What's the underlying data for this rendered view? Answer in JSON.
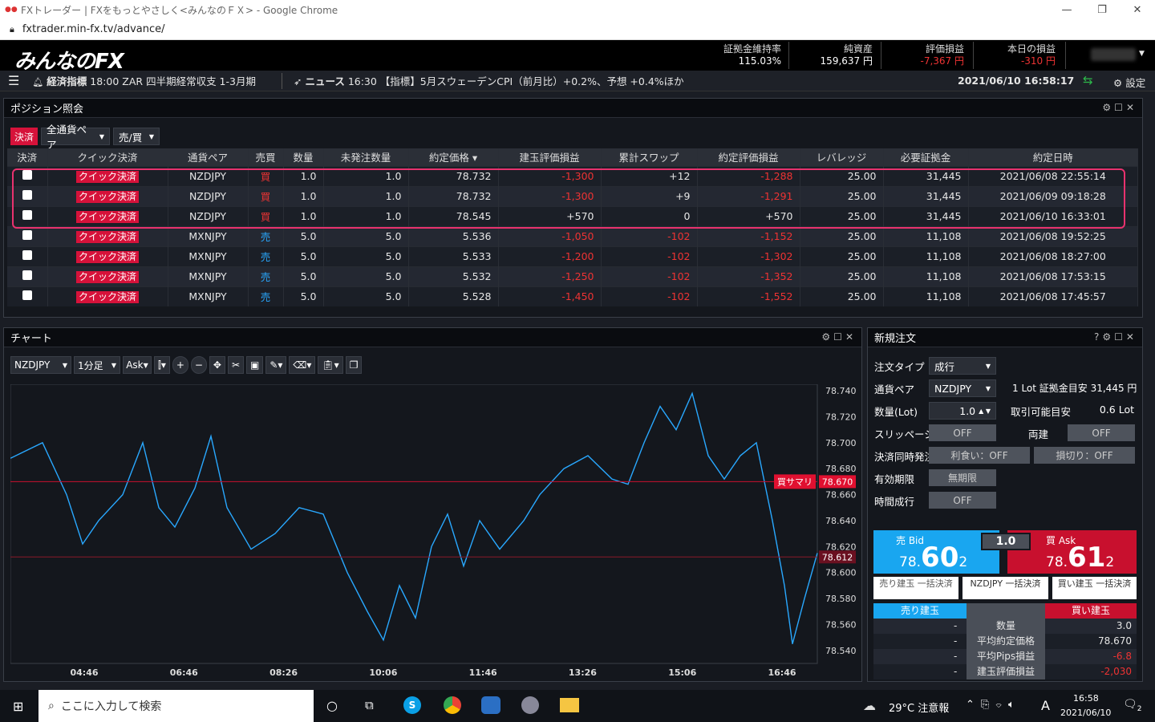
{
  "browser": {
    "title": "FXトレーダー | FXをもっとやさしく<みんなのＦＸ> - Google Chrome",
    "url": "fxtrader.min-fx.tv/advance/"
  },
  "header": {
    "logo": "みんなのFX",
    "stats": [
      {
        "label": "証拠金維持率",
        "value": "115.03%",
        "neg": false
      },
      {
        "label": "純資産",
        "value": "159,637 円",
        "neg": false
      },
      {
        "label": "評価損益",
        "value": "-7,367 円",
        "neg": true
      },
      {
        "label": "本日の損益",
        "value": "-310 円",
        "neg": true
      }
    ]
  },
  "news": {
    "econ_label": "経済指標",
    "econ_text": "18:00 ZAR 四半期経常収支 1-3月期",
    "news_label": "ニュース",
    "news_text": "16:30 【指標】5月スウェーデンCPI（前月比）+0.2%、予想 +0.4%ほか",
    "datetime": "2021/06/10 16:58:17",
    "settings": "設定"
  },
  "positions": {
    "title": "ポジション照会",
    "filters": {
      "settle": "決済",
      "pair": "全通貨ペア",
      "side": "売/買"
    },
    "columns": [
      "決済",
      "クイック決済",
      "通貨ペア",
      "売買",
      "数量",
      "未発注数量",
      "約定価格 ▾",
      "建玉評価損益",
      "累計スワップ",
      "約定評価損益",
      "レバレッジ",
      "必要証拠金",
      "約定日時"
    ],
    "quick_label": "クイック決済",
    "rows": [
      {
        "pair": "NZDJPY",
        "side": "買",
        "qty": "1.0",
        "unfilled": "1.0",
        "price": "78.732",
        "pl": "-1,300",
        "swap": "+12",
        "total": "-1,288",
        "lev": "25.00",
        "margin": "31,445",
        "dt": "2021/06/08 22:55:14"
      },
      {
        "pair": "NZDJPY",
        "side": "買",
        "qty": "1.0",
        "unfilled": "1.0",
        "price": "78.732",
        "pl": "-1,300",
        "swap": "+9",
        "total": "-1,291",
        "lev": "25.00",
        "margin": "31,445",
        "dt": "2021/06/09 09:18:28"
      },
      {
        "pair": "NZDJPY",
        "side": "買",
        "qty": "1.0",
        "unfilled": "1.0",
        "price": "78.545",
        "pl": "+570",
        "swap": "0",
        "total": "+570",
        "lev": "25.00",
        "margin": "31,445",
        "dt": "2021/06/10 16:33:01"
      },
      {
        "pair": "MXNJPY",
        "side": "売",
        "qty": "5.0",
        "unfilled": "5.0",
        "price": "5.536",
        "pl": "-1,050",
        "swap": "-102",
        "total": "-1,152",
        "lev": "25.00",
        "margin": "11,108",
        "dt": "2021/06/08 19:52:25"
      },
      {
        "pair": "MXNJPY",
        "side": "売",
        "qty": "5.0",
        "unfilled": "5.0",
        "price": "5.533",
        "pl": "-1,200",
        "swap": "-102",
        "total": "-1,302",
        "lev": "25.00",
        "margin": "11,108",
        "dt": "2021/06/08 18:27:00"
      },
      {
        "pair": "MXNJPY",
        "side": "売",
        "qty": "5.0",
        "unfilled": "5.0",
        "price": "5.532",
        "pl": "-1,250",
        "swap": "-102",
        "total": "-1,352",
        "lev": "25.00",
        "margin": "11,108",
        "dt": "2021/06/08 17:53:15"
      },
      {
        "pair": "MXNJPY",
        "side": "売",
        "qty": "5.0",
        "unfilled": "5.0",
        "price": "5.528",
        "pl": "-1,450",
        "swap": "-102",
        "total": "-1,552",
        "lev": "25.00",
        "margin": "11,108",
        "dt": "2021/06/08 17:45:57"
      }
    ]
  },
  "chart": {
    "title": "チャート",
    "toolbar": {
      "pair": "NZDJPY",
      "interval": "1分足",
      "side": "Ask"
    },
    "y_ticks": [
      "78.740",
      "78.720",
      "78.700",
      "78.680",
      "78.660",
      "78.640",
      "78.620",
      "78.600",
      "78.580",
      "78.560",
      "78.540"
    ],
    "x_ticks": [
      "04:46",
      "06:46",
      "08:26",
      "10:06",
      "11:46",
      "13:26",
      "15:06",
      "16:46"
    ],
    "avg_line": {
      "label": "買サマリ",
      "price": "78.670"
    },
    "current_price": "78.612",
    "ylim": [
      78.53,
      78.745
    ]
  },
  "order": {
    "title": "新規注文",
    "order_type_label": "注文タイプ",
    "order_type": "成行",
    "pair_label": "通貨ペア",
    "pair": "NZDJPY",
    "lot_info": "1 Lot 証拠金目安 31,445 円",
    "qty_label": "数量(Lot)",
    "qty": "1.0",
    "tradable_label": "取引可能目安",
    "tradable": "0.6 Lot",
    "slip_label": "スリッページ",
    "slip": "OFF",
    "both_label": "両建",
    "both": "OFF",
    "settle_label": "決済同時発注",
    "tp": "利食い：OFF",
    "sl": "損切り：OFF",
    "expiry_label": "有効期限",
    "expiry": "無期限",
    "time_label": "時間成行",
    "time": "OFF",
    "bid_label": "売 Bid",
    "bid_small": "78.",
    "bid_big": "60",
    "bid_sub": "2",
    "ask_label": "買 Ask",
    "ask_small": "78.",
    "ask_big": "61",
    "ask_sub": "2",
    "lot_value": "1.0",
    "sell_close": "売り建玉 一括決済",
    "pair_close": "NZDJPY 一括決済",
    "buy_close": "買い建玉 一括決済",
    "sell_pos": "売り建玉",
    "buy_pos": "買い建玉",
    "summary": [
      {
        "label": "数量",
        "sell": "-",
        "buy": "3.0",
        "neg": false
      },
      {
        "label": "平均約定価格",
        "sell": "-",
        "buy": "78.670",
        "neg": false
      },
      {
        "label": "平均Pips損益",
        "sell": "-",
        "buy": "-6.8",
        "neg": true
      },
      {
        "label": "建玉評価損益",
        "sell": "-",
        "buy": "-2,030",
        "neg": true
      }
    ]
  },
  "taskbar": {
    "search": "ここに入力して検索",
    "weather": "29°C 注意報",
    "ime": "A",
    "time": "16:58",
    "date": "2021/06/10",
    "notif": "2"
  }
}
